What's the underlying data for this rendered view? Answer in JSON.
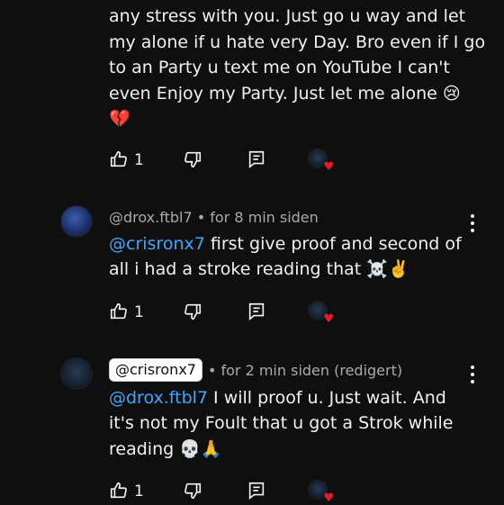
{
  "colors": {
    "background": "#0f0f0f",
    "text": "#f1f1f1",
    "mention": "#3ea6ff",
    "meta": "#aaaaaa",
    "heart": "#e8192c"
  },
  "top_comment": {
    "lines": [
      "any stress with you. Just go u way and let",
      "my alone if u hate very Day. Bro even if I go",
      "to an Party u text me on YouTube  I can't",
      "even Enjoy my Party. Just let me alone"
    ],
    "emoji_line4": "😢",
    "emoji_line5": "💔",
    "likes": "1"
  },
  "reply1": {
    "author": "@drox.ftbl7",
    "time": "• for 8 min siden",
    "mention": "@crisronx7",
    "line1_rest": " first give proof and second of",
    "line2": "all i had a stroke reading that ",
    "line2_emoji": "☠️✌️",
    "likes": "1"
  },
  "reply2": {
    "author": "@crisronx7",
    "time": "• for 2 min siden (redigert)",
    "mention": "@drox.ftbl7",
    "line1_rest": " I will proof u. Just wait. And",
    "line2": "it's not my Foult that u got a Strok while",
    "line3": "reading ",
    "line3_emoji": "💀🙏",
    "likes": "1"
  },
  "icons": {
    "like": "thumbs-up-icon",
    "dislike": "thumbs-down-icon",
    "reply": "reply-icon",
    "creator_heart": "creator-heart-icon",
    "more": "more-vertical-icon"
  }
}
